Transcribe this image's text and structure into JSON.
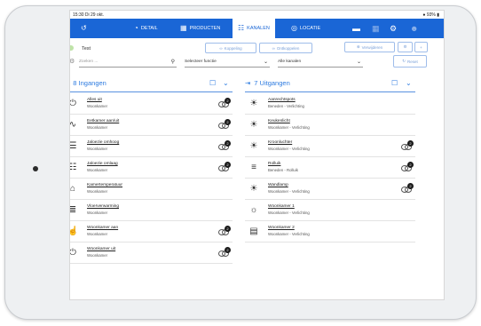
{
  "status": {
    "time": "15:30",
    "date": "Di 29 okt.",
    "battery": "93%"
  },
  "nav": {
    "back_icon": "back-arrow-icon",
    "tabs": [
      {
        "label": "DETAIL",
        "icon": "dashboard-icon"
      },
      {
        "label": "PRODUCTEN",
        "icon": "products-icon"
      },
      {
        "label": "KANALEN",
        "icon": "channels-icon",
        "active": true
      },
      {
        "label": "LOCATIE",
        "icon": "location-icon"
      }
    ]
  },
  "toolbar": {
    "device_name": "Test",
    "search_placeholder": "Zoeken ...",
    "koppeling_label": "Koppeling",
    "ontkoppelen_label": "Ontkoppelen",
    "verwijderen_label": "Verwijderen",
    "function_filter": "Selecteer functie",
    "channel_filter": "Alle kanalen",
    "reset_label": "Reset"
  },
  "inputs_column": {
    "title": "8 Ingangen",
    "items": [
      {
        "name": "Alles uit",
        "location": "Woonkamer",
        "icon": "power-icon",
        "linked": true
      },
      {
        "name": "Eetkamer aan/uit",
        "location": "Woonkamer",
        "icon": "wave-icon",
        "linked": true
      },
      {
        "name": "Jaloezie omhoog",
        "location": "Woonkamer",
        "icon": "blind-up-icon",
        "linked": true
      },
      {
        "name": "Jaloezie omlaag",
        "location": "Woonkamer",
        "icon": "blind-down-icon",
        "linked": true
      },
      {
        "name": "Kamertemperatuur",
        "location": "Woonkamer",
        "icon": "home-temperature-icon",
        "linked": false
      },
      {
        "name": "Vloerverwarming",
        "location": "Woonkamer",
        "icon": "floor-heating-icon",
        "linked": false
      },
      {
        "name": "Woonkamer aan",
        "location": "Woonkamer",
        "icon": "hand-touch-icon",
        "linked": true
      },
      {
        "name": "Woonkamer uit",
        "location": "Woonkamer",
        "icon": "power-icon",
        "linked": true
      }
    ]
  },
  "outputs_column": {
    "title": "7 Uitgangen",
    "items": [
      {
        "name": "Aanrechtspots",
        "location": "Beneden - Verlichting",
        "icon": "light-icon",
        "linked": false
      },
      {
        "name": "Keukenlicht",
        "location": "Woonkamer - Verlichting",
        "icon": "light-icon",
        "linked": false
      },
      {
        "name": "Kroonluchter",
        "location": "Woonkamer - Verlichting",
        "icon": "light-icon",
        "linked": true
      },
      {
        "name": "Rolluik",
        "location": "Beneden - Rolluik",
        "icon": "shutter-icon",
        "linked": true
      },
      {
        "name": "Wandlamp",
        "location": "Woonkamer - Verlichting",
        "icon": "light-icon",
        "linked": true
      },
      {
        "name": "Woonkamer 1",
        "location": "Woonkamer - Verlichting",
        "icon": "dimmer-light-icon",
        "linked": false
      },
      {
        "name": "Woonkamer 2",
        "location": "Woonkamer - Verlichting",
        "icon": "pwm-icon",
        "linked": false
      }
    ]
  },
  "link_badge": "2",
  "colors": {
    "accent": "#1a66d6",
    "toggle": "#bfe3a8"
  }
}
